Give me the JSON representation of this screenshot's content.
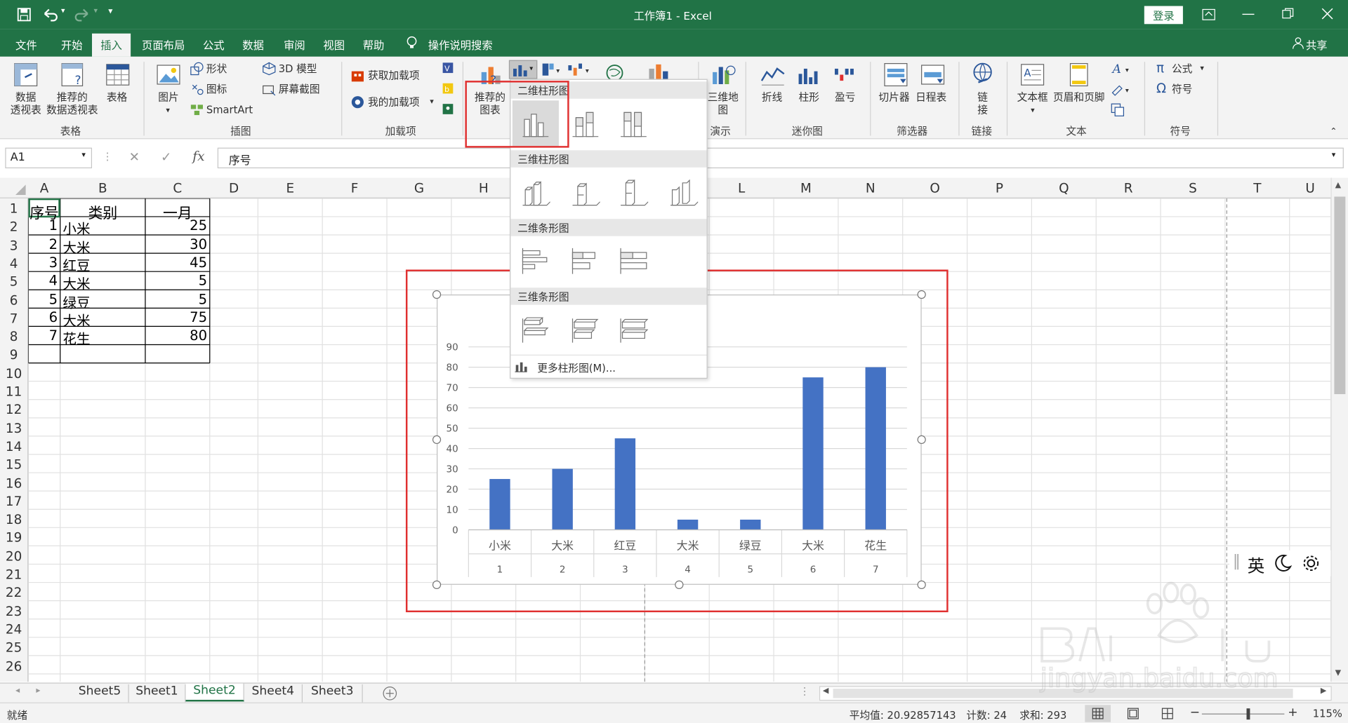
{
  "titlebar": {
    "title": "工作簿1 - Excel",
    "login": "登录"
  },
  "menu_tabs": [
    "文件",
    "开始",
    "插入",
    "页面布局",
    "公式",
    "数据",
    "审阅",
    "视图",
    "帮助"
  ],
  "search_hint": "操作说明搜索",
  "share": "共享",
  "ribbon": {
    "pivot_table": "数据\n透视表",
    "recommended_pivot": "推荐的\n数据透视表",
    "table": "表格",
    "group_tables": "表格",
    "picture": "图片",
    "shapes": "形状",
    "icons": "图标",
    "smartart": "SmartArt",
    "model3d": "3D 模型",
    "screenshot": "屏幕截图",
    "group_illustrations": "插图",
    "get_addins": "获取加载项",
    "my_addins": "我的加载项",
    "group_addins": "加载项",
    "recommended_charts": "推荐的\n图表",
    "map3d": "三维地\n图",
    "group_tours": "演示",
    "spark_line": "折线",
    "spark_column": "柱形",
    "spark_winloss": "盈亏",
    "group_sparklines": "迷你图",
    "slicer": "切片器",
    "timeline": "日程表",
    "group_filters": "筛选器",
    "link": "链\n接",
    "group_links": "链接",
    "textbox": "文本框",
    "header_footer": "页眉和页脚",
    "group_text": "文本",
    "equation": "公式",
    "symbol": "符号",
    "group_symbols": "符号"
  },
  "formula_bar": {
    "name_box": "A1",
    "formula": "序号"
  },
  "columns": [
    "A",
    "B",
    "C",
    "D",
    "E",
    "F",
    "G",
    "H",
    "I",
    "J",
    "K",
    "L",
    "M",
    "N",
    "O",
    "P",
    "Q",
    "R",
    "S",
    "T",
    "U"
  ],
  "rows": [
    "1",
    "2",
    "3",
    "4",
    "5",
    "6",
    "7",
    "8",
    "9",
    "10",
    "11",
    "12",
    "13",
    "14",
    "15",
    "16",
    "17",
    "18",
    "19",
    "20",
    "21",
    "22",
    "23",
    "24",
    "25",
    "26"
  ],
  "table": {
    "headers": [
      "序号",
      "类别",
      "一月"
    ],
    "rows": [
      [
        "1",
        "小米",
        "25"
      ],
      [
        "2",
        "大米",
        "30"
      ],
      [
        "3",
        "红豆",
        "45"
      ],
      [
        "4",
        "大米",
        "5"
      ],
      [
        "5",
        "绿豆",
        "5"
      ],
      [
        "6",
        "大米",
        "75"
      ],
      [
        "7",
        "花生",
        "80"
      ]
    ]
  },
  "dropdown": {
    "section_2d_column": "二维柱形图",
    "section_3d_column": "三维柱形图",
    "section_2d_bar": "二维条形图",
    "section_3d_bar": "三维条形图",
    "more": "更多柱形图(M)..."
  },
  "chart_data": {
    "type": "bar",
    "categories": [
      "小米",
      "大米",
      "红豆",
      "大米",
      "绿豆",
      "大米",
      "花生"
    ],
    "category_index": [
      "1",
      "2",
      "3",
      "4",
      "5",
      "6",
      "7"
    ],
    "values": [
      25,
      30,
      45,
      5,
      5,
      75,
      80
    ],
    "ylim": [
      0,
      90
    ],
    "yticks": [
      "0",
      "10",
      "20",
      "30",
      "40",
      "50",
      "60",
      "70",
      "80",
      "90"
    ],
    "color": "#4472c4",
    "grid": true
  },
  "sheets": [
    "Sheet5",
    "Sheet1",
    "Sheet2",
    "Sheet4",
    "Sheet3"
  ],
  "active_sheet": "Sheet2",
  "status": {
    "ready": "就绪",
    "average": "平均值: 20.92857143",
    "count": "计数: 24",
    "sum": "求和: 293",
    "zoom": "115%"
  },
  "ime": {
    "lang": "英"
  },
  "colors": {
    "excel_green": "#217346",
    "highlight_red": "#e03030"
  }
}
